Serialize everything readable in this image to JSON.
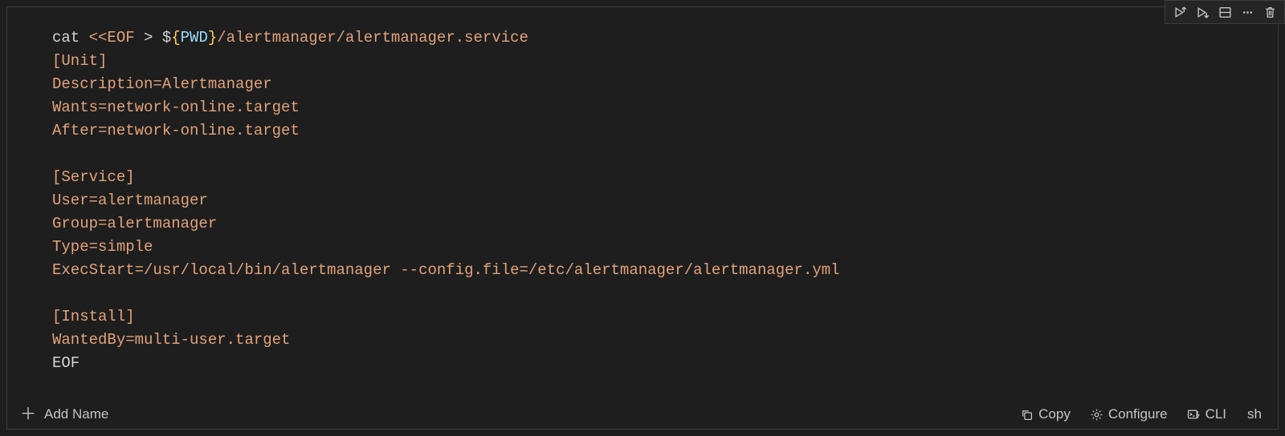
{
  "toolbar": {
    "run_up": "Run above",
    "run_down": "Run below",
    "split": "Split",
    "more": "More",
    "delete": "Delete"
  },
  "code": {
    "cat": "cat ",
    "heredoc_open": "<<EOF",
    "redirect": " > ",
    "dollar": "$",
    "lbrace": "{",
    "pwd": "PWD",
    "rbrace": "}",
    "path": "/alertmanager/alertmanager.service",
    "body_lines": [
      "[Unit]",
      "Description=Alertmanager",
      "Wants=network-online.target",
      "After=network-online.target",
      "",
      "[Service]",
      "User=alertmanager",
      "Group=alertmanager",
      "Type=simple",
      "ExecStart=/usr/local/bin/alertmanager --config.file=/etc/alertmanager/alertmanager.yml",
      "",
      "[Install]",
      "WantedBy=multi-user.target"
    ],
    "eof": "EOF"
  },
  "bottom": {
    "add_name": "Add Name",
    "copy": "Copy",
    "configure": "Configure",
    "cli": "CLI",
    "lang": "sh"
  }
}
